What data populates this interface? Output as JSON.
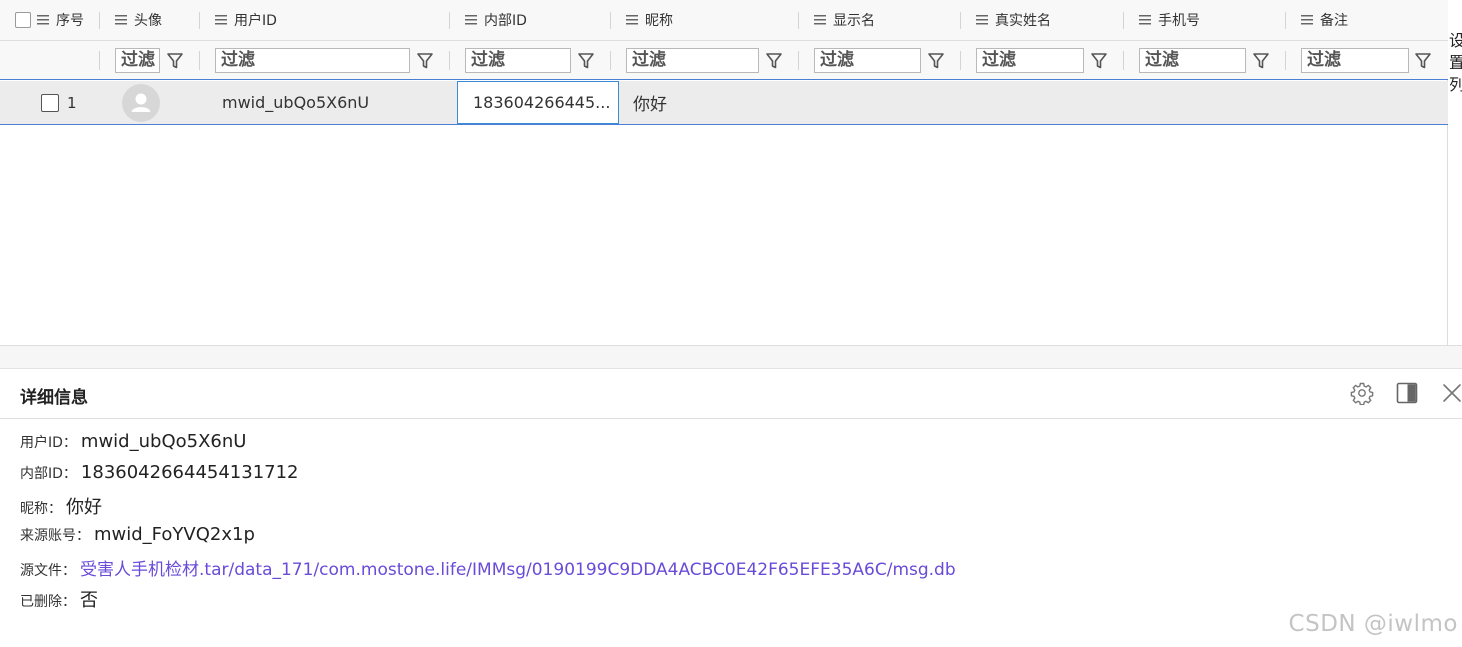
{
  "table": {
    "columns": [
      {
        "label": "序号"
      },
      {
        "label": "头像"
      },
      {
        "label": "用户ID"
      },
      {
        "label": "内部ID"
      },
      {
        "label": "昵称"
      },
      {
        "label": "显示名"
      },
      {
        "label": "真实姓名"
      },
      {
        "label": "手机号"
      },
      {
        "label": "备注"
      }
    ],
    "filter_placeholder": "过滤",
    "rows": [
      {
        "index": "1",
        "user_id": "mwid_ubQo5X6nU",
        "internal_id": "183604266445...",
        "nickname": "你好",
        "display_name": "",
        "real_name": "",
        "phone": "",
        "remark": ""
      }
    ],
    "side_strip": "设置列"
  },
  "details": {
    "title": "详细信息",
    "fields": [
      {
        "label": "用户ID：",
        "value": "mwid_ubQo5X6nU"
      },
      {
        "label": "内部ID：",
        "value": "1836042664454131712"
      },
      {
        "label": "昵称：",
        "value": "你好"
      },
      {
        "label": "来源账号：",
        "value": "mwid_FoYVQ2x1p"
      },
      {
        "label": "源文件：",
        "value": "受害人手机检材.tar/data_171/com.mostone.life/IMMsg/0190199C9DDA4ACBC0E42F65EFE35A6C/msg.db"
      },
      {
        "label": "已删除：",
        "value": "否"
      }
    ],
    "icons": [
      "gear-icon",
      "panel-toggle-icon",
      "close-icon"
    ]
  },
  "watermark": "CSDN @iwlmo",
  "colors": {
    "selection_border": "#4a7fd4",
    "link": "#6a4bd8",
    "row_background": "#ececec",
    "header_background": "#f8f8f8"
  }
}
